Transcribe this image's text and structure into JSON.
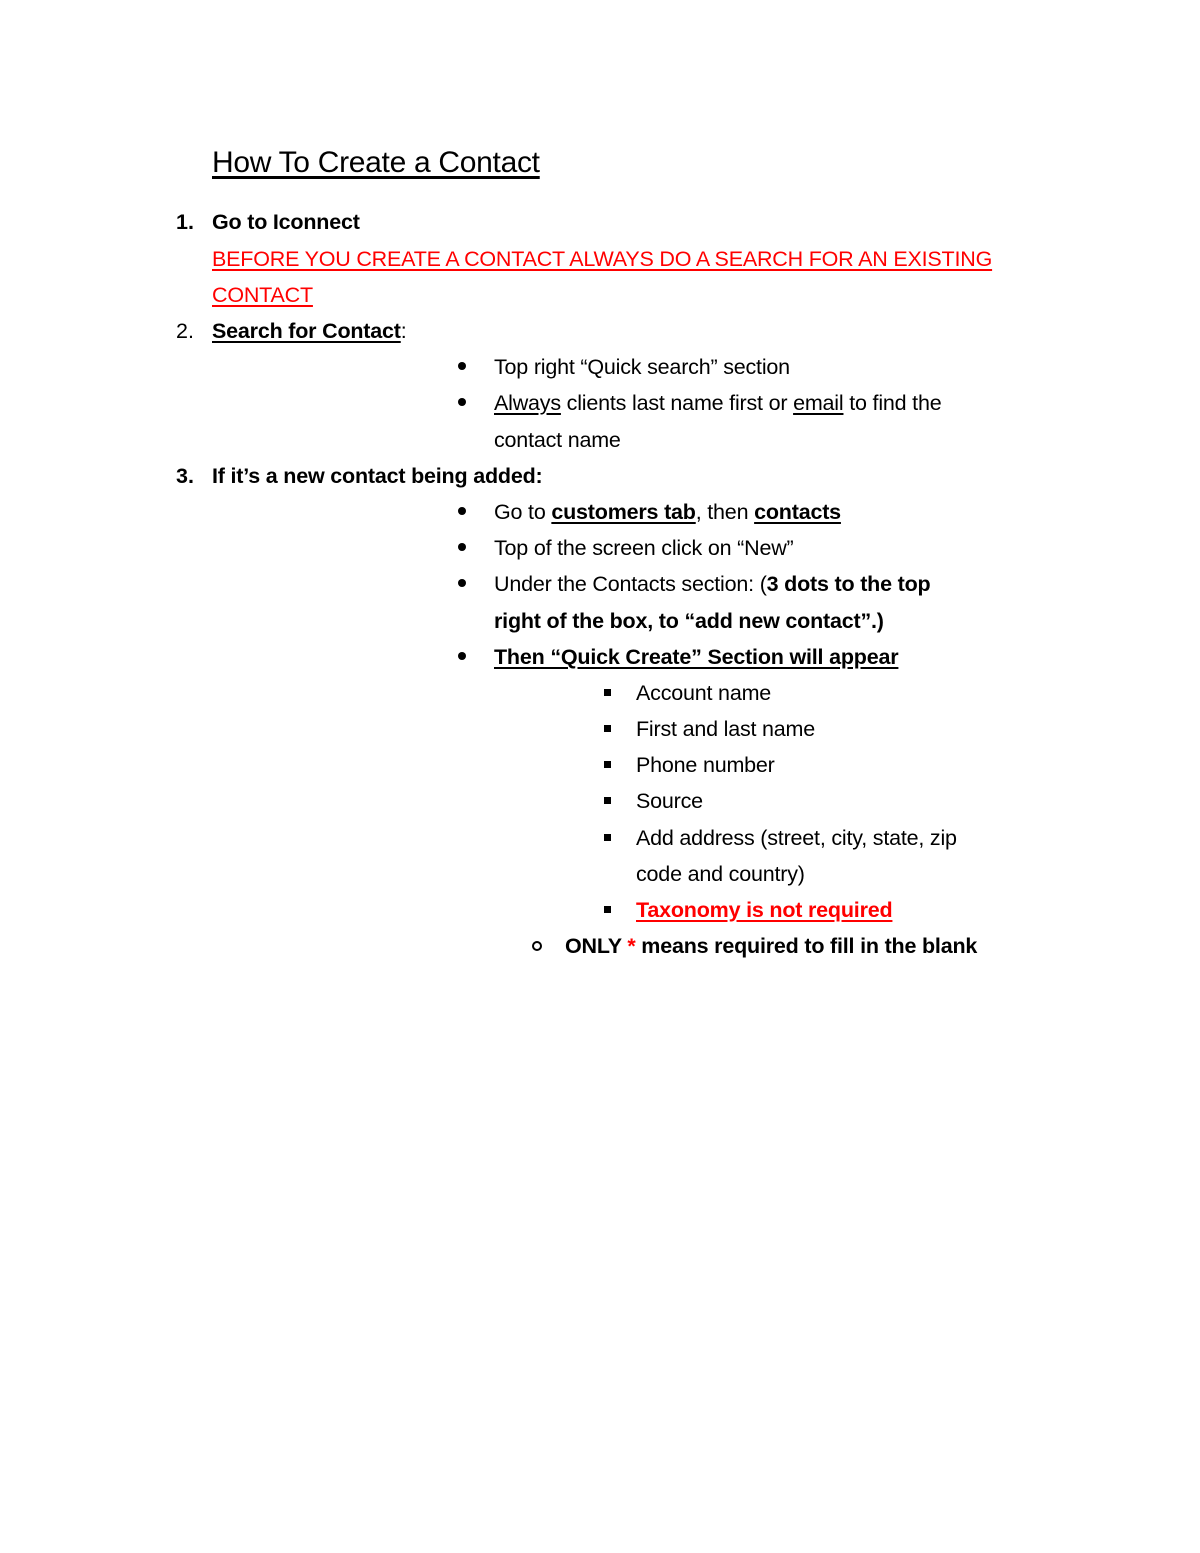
{
  "document": {
    "title": "How To Create a Contact",
    "steps": [
      {
        "number": "1.",
        "label": "Go to Iconnect",
        "warning_line1": "BEFORE YOU CREATE A CONTACT ALWAYS DO A SEARCH FOR AN EXISTING ",
        "warning_line2": "CONTACT"
      },
      {
        "number": "2.",
        "label": "Search for Contact",
        "label_suffix": ":",
        "bullets": [
          {
            "text": "Top right “Quick search” section"
          },
          {
            "part1": "Always",
            "part2": " clients last name first or ",
            "part3": "email",
            "part4": " to find the",
            "line2": "contact name"
          }
        ]
      },
      {
        "number": "3.",
        "label": "If it’s a new contact being added:",
        "bullets": [
          {
            "part1": "Go to ",
            "part2": "customers tab",
            "part3": ", then ",
            "part4": "contacts"
          },
          {
            "text": "Top of the screen click on “New”"
          },
          {
            "part1": "Under the Contacts section: ",
            "part2": "(",
            "part3": "3 dots to the top",
            "line2": "right of the box, to “add new contact”.)"
          },
          {
            "text": "Then “Quick Create” Section will appear"
          }
        ],
        "fields": [
          {
            "text": "Account name"
          },
          {
            "text": "First and last name"
          },
          {
            "text": "Phone number"
          },
          {
            "text": "Source"
          },
          {
            "line1": "Add address (street, city, state, zip",
            "line2": "code and country)"
          },
          {
            "text": "Taxonomy is not required "
          }
        ],
        "note": {
          "part1": "ONLY ",
          "asterisk": "*",
          "part2": " means required to fill in the blank"
        }
      }
    ]
  },
  "colors": {
    "text": "#000000",
    "warning": "#ff0000"
  }
}
